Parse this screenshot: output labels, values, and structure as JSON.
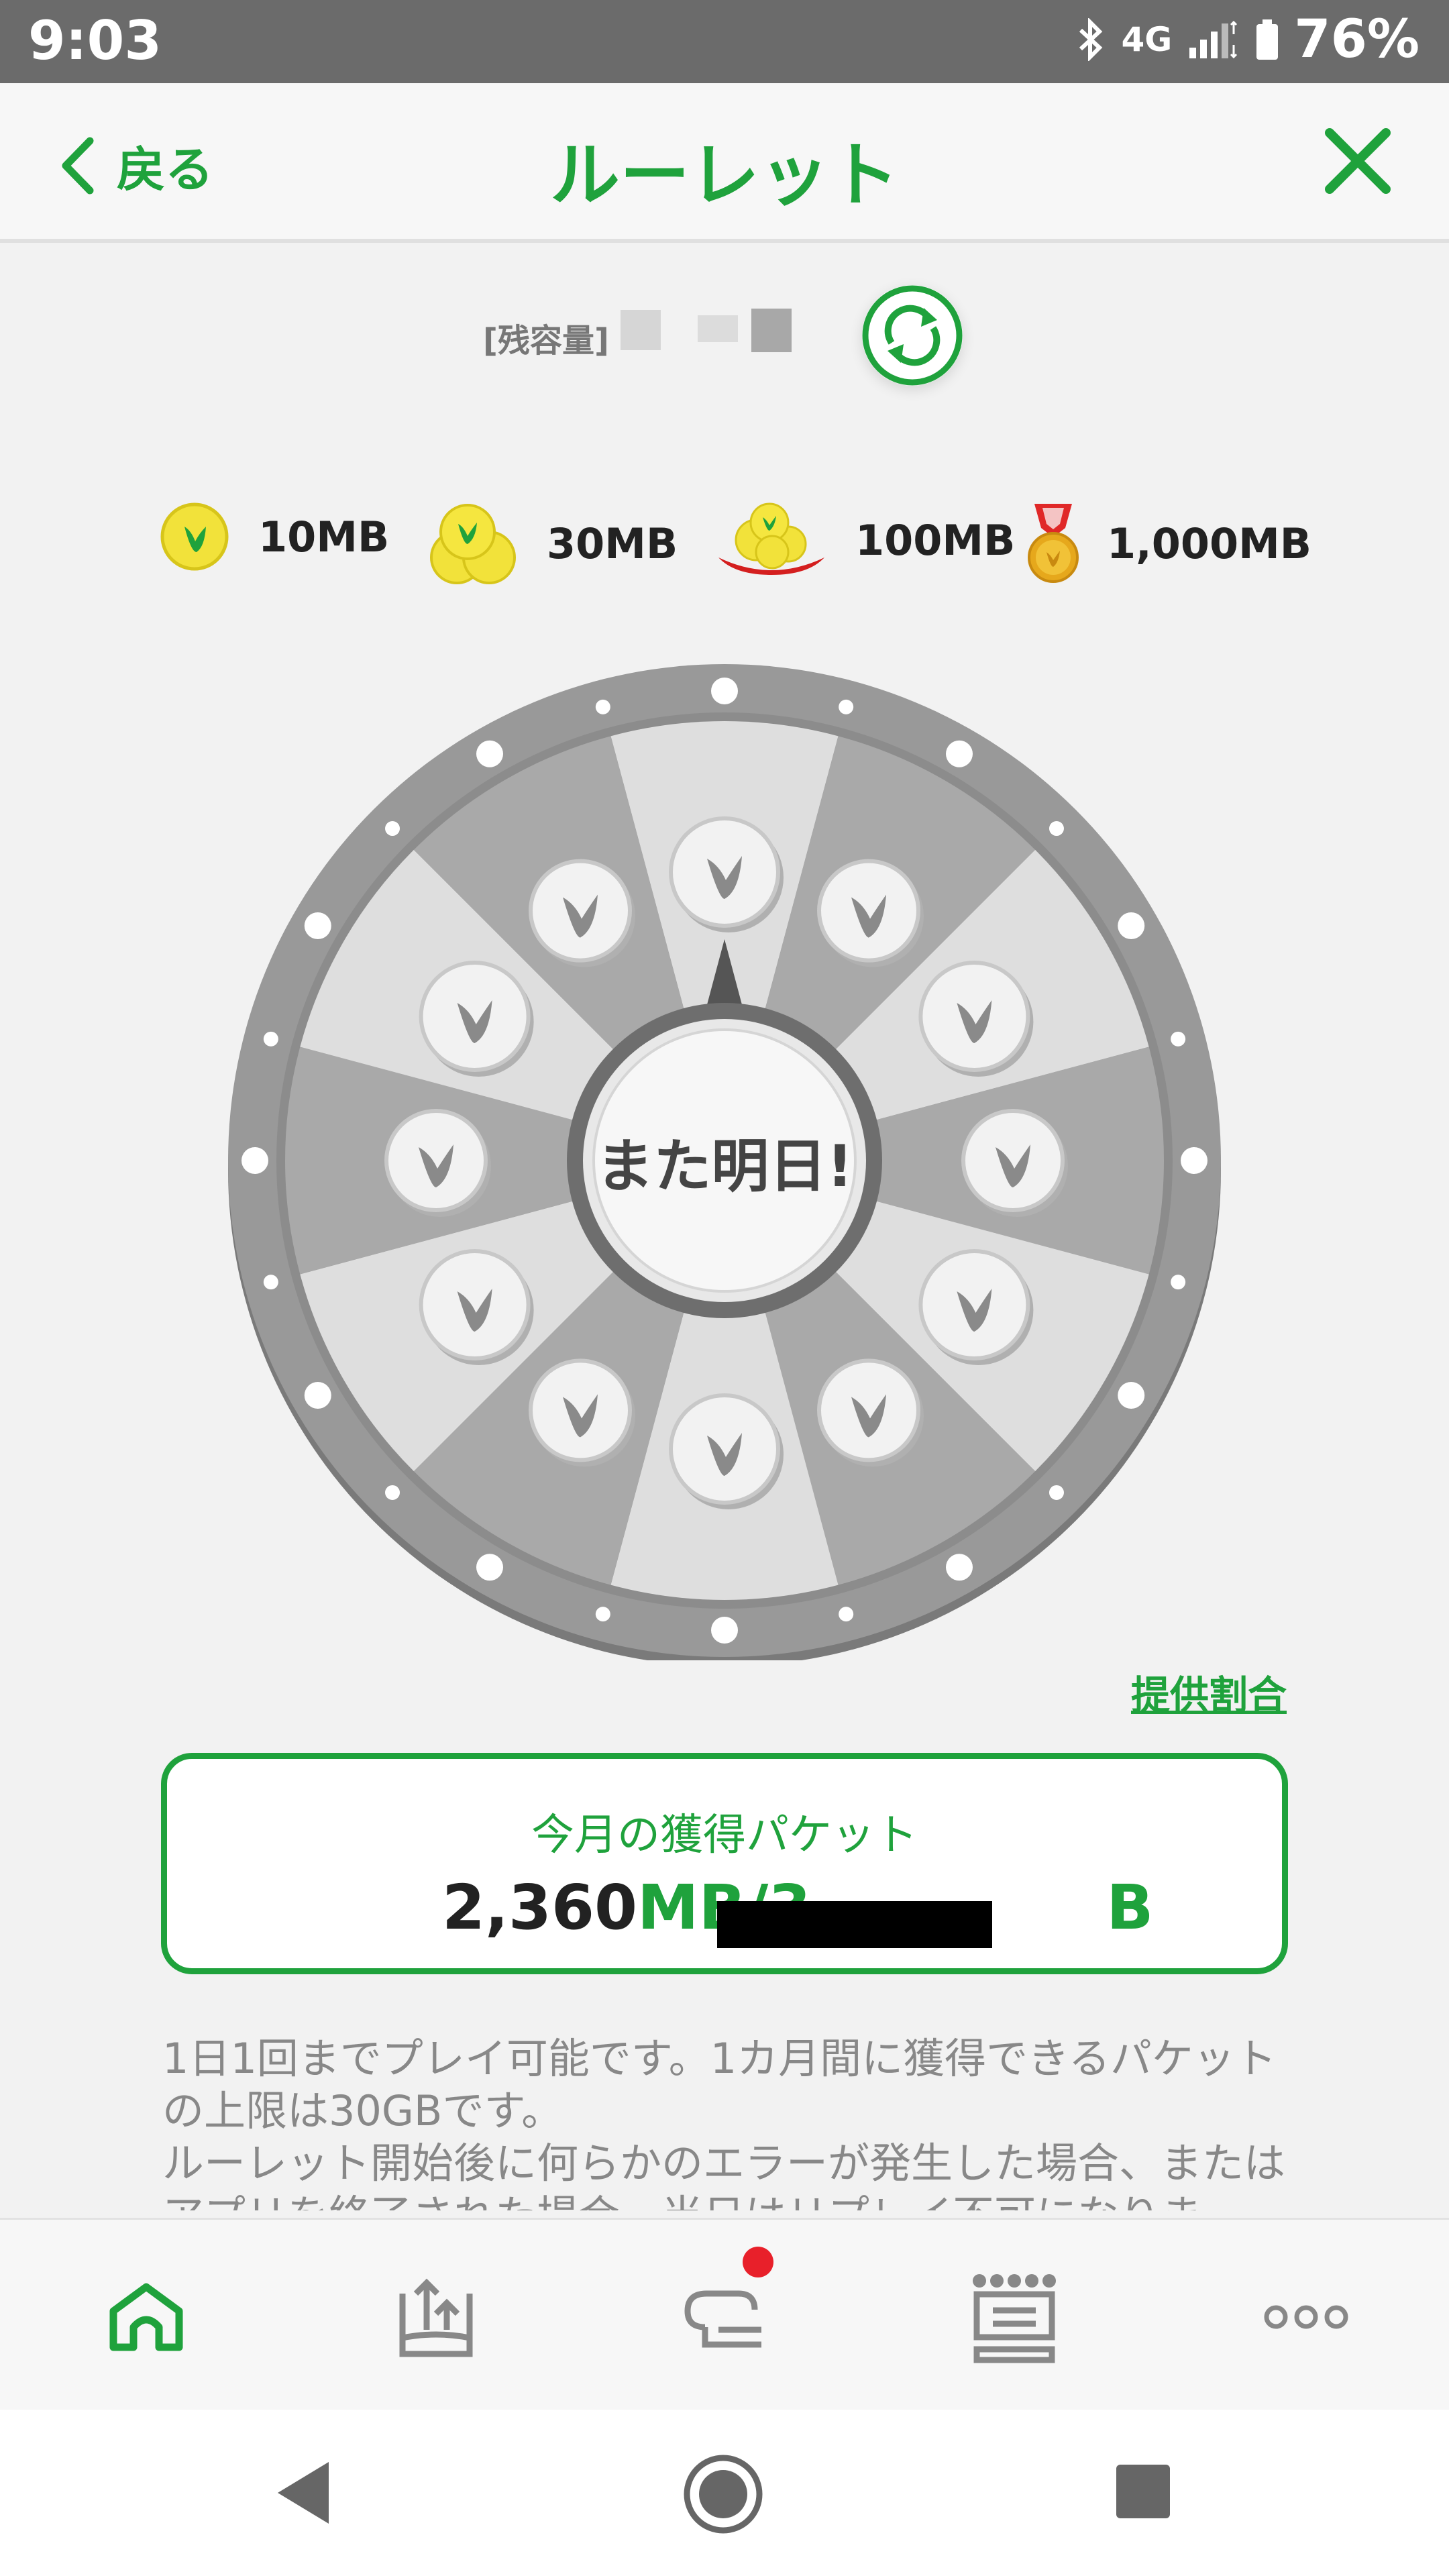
{
  "status_bar": {
    "time": "9:03",
    "network": "4G",
    "battery": "76%"
  },
  "header": {
    "back_label": "戻る",
    "title": "ルーレット"
  },
  "remaining": {
    "label": "[残容量]"
  },
  "legend": [
    {
      "icon": "single-coin-icon",
      "label": "10MB"
    },
    {
      "icon": "coin-stack-icon",
      "label": "30MB"
    },
    {
      "icon": "coin-tray-icon",
      "label": "100MB"
    },
    {
      "icon": "gold-medal-icon",
      "label": "1,000MB"
    }
  ],
  "wheel": {
    "center_label": "また明日!"
  },
  "rate_link": "提供割合",
  "packet": {
    "label": "今月の獲得パケット",
    "value": "2,360",
    "unit": "MB/3",
    "suffix": "B"
  },
  "description": "1日1回までプレイ可能です。1カ月間に獲得できるパケットの上限は30GBです。\nルーレット開始後に何らかのエラーが発生した場合、またはアプリを終了された場合、当日はリプレイ不可になりま",
  "colors": {
    "accent": "#1fa23c",
    "badge": "#e8202a"
  },
  "tabs": [
    {
      "icon": "home-icon",
      "active": true
    },
    {
      "icon": "data-charge-icon",
      "active": false
    },
    {
      "icon": "chat-icon",
      "active": false,
      "badge": true
    },
    {
      "icon": "crown-icon",
      "active": false
    },
    {
      "icon": "more-icon",
      "active": false
    }
  ],
  "nav": [
    "back-icon",
    "home-icon",
    "recents-icon"
  ]
}
